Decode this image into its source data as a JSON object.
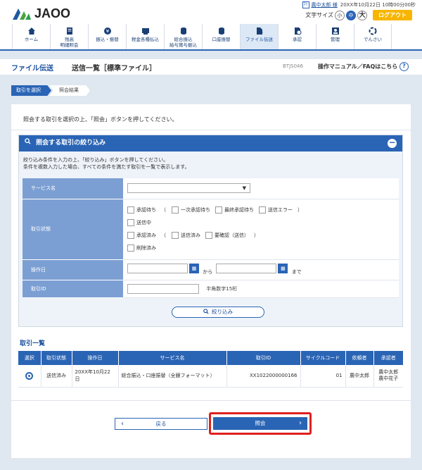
{
  "header": {
    "logo_text": "JAOO",
    "user_icon": "ﾏｲ",
    "user_name": "農中太郎 様",
    "datetime": "20XX年10月22日 10時00分00秒",
    "font_size_label": "文字サイズ",
    "font_sizes": [
      "小",
      "中",
      "大"
    ],
    "logout": "ログアウト"
  },
  "nav": {
    "items": [
      {
        "label": "ホーム",
        "icon": "home-icon"
      },
      {
        "label": "残高\n明細照会",
        "icon": "balance-icon"
      },
      {
        "label": "振込・振替",
        "icon": "transfer-icon"
      },
      {
        "label": "税金各種払込",
        "icon": "tax-icon"
      },
      {
        "label": "総合振込\n給与賞与振込",
        "icon": "salary-icon"
      },
      {
        "label": "口座振替",
        "icon": "account-icon"
      },
      {
        "label": "ファイル伝送",
        "icon": "file-icon"
      },
      {
        "label": "承認",
        "icon": "approval-icon"
      },
      {
        "label": "管理",
        "icon": "admin-icon"
      },
      {
        "label": "でんさい",
        "icon": "densai-icon"
      }
    ]
  },
  "title": {
    "main": "ファイル伝送",
    "sub": "送信一覧［標準ファイル］",
    "code": "BTJS046",
    "help": "操作マニュアル／FAQはこちら",
    "help_icon": "?"
  },
  "steps": [
    "取引を選択",
    "照会結果"
  ],
  "intro": "照会する取引を選択の上、「照会」ボタンを押してください。",
  "filter": {
    "title": "照会する取引の絞り込み",
    "collapse": "−",
    "note1": "絞り込み条件を入力の上、「絞り込み」ボタンを押してください。",
    "note2": "条件を複数入力した場合、すべての条件を満たす取引を一覧で表示します。",
    "service_label": "サービス名",
    "status_label": "取引状態",
    "status_options": {
      "pending": "承認待ち",
      "first": "一次承認待ち",
      "final": "最終承認待ち",
      "send_error": "送信エラー",
      "sending": "送信中",
      "approved": "承認済み",
      "sent": "送信済み",
      "confirm": "要確認（送信）",
      "deleted": "削除済み"
    },
    "op_date_label": "操作日",
    "from": "から",
    "to": "まで",
    "cal": "▦",
    "trans_id_label": "取引ID",
    "trans_id_hint": "半角数字15桁",
    "button": "絞り込み",
    "paren_open": "（",
    "paren_close": "）"
  },
  "list": {
    "title": "取引一覧",
    "headers": [
      "選択",
      "取引状態",
      "操作日",
      "サービス名",
      "取引ID",
      "サイクルコード",
      "依頼者",
      "承認者"
    ],
    "rows": [
      {
        "status": "送信済み",
        "date": "20XX年10月22日",
        "service": "総合振込・口座振替（全銀フォーマット）",
        "id": "XX1022000000166",
        "cycle": "01",
        "requester": "農中太郎",
        "approver1": "農中太郎",
        "approver2": "農中花子"
      }
    ]
  },
  "buttons": {
    "back": "戻る",
    "back_arrow": "‹",
    "inquiry": "照会",
    "inquiry_arrow": "›"
  },
  "colors": {
    "accent": "#2a64b5",
    "logout": "#f7b500",
    "highlight": "#e02020"
  }
}
